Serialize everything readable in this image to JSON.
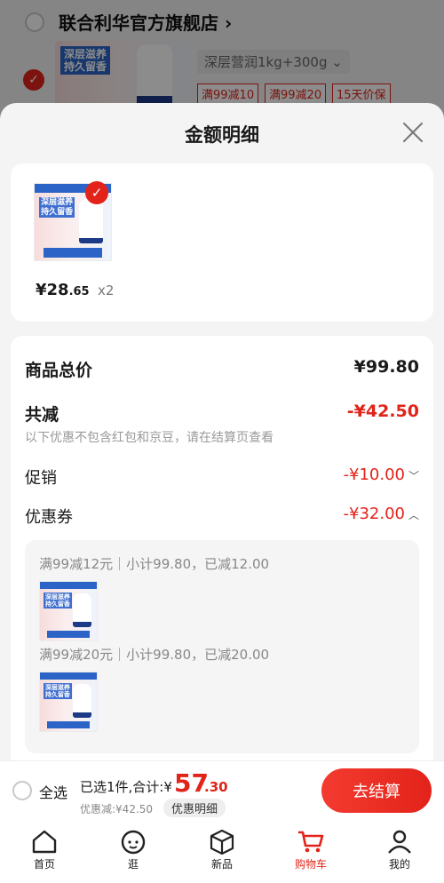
{
  "store": {
    "name": "联合利华官方旗舰店",
    "name_arrow": "›",
    "thumb_text": "深层滋养\n持久留香",
    "spec": "深层营润1kg+300g ⌄",
    "promo_tags": [
      "满99减10",
      "满99减20",
      "15天价保"
    ]
  },
  "sheet": {
    "title": "金额明细",
    "product": {
      "price_int": "¥28",
      "price_dec": ".65",
      "qty": "x2",
      "img_text": "深层滋养\n持久留香"
    },
    "total_label": "商品总价",
    "total_value": "¥99.80",
    "reduce_label": "共减",
    "reduce_value": "-¥42.50",
    "note": "以下优惠不包含红包和京豆，请在结算页查看",
    "promo_label": "促销",
    "promo_value": "-¥10.00",
    "coupon_label": "优惠券",
    "coupon_value": "-¥32.00",
    "coupons": [
      {
        "text": "满99减12元｜小计99.80，已减12.00"
      },
      {
        "text": "满99减20元｜小计99.80，已减20.00"
      }
    ]
  },
  "bottom": {
    "select_all": "全选",
    "summary": "已选1件,合计:¥",
    "total_int": "57",
    "total_dec": ".30",
    "discount": "优惠减:¥42.50",
    "detail_pill": "优惠明细",
    "checkout": "去结算"
  },
  "tabs": [
    {
      "label": "首页"
    },
    {
      "label": "逛"
    },
    {
      "label": "新品"
    },
    {
      "label": "购物车"
    },
    {
      "label": "我的"
    }
  ],
  "colors": {
    "accent": "#e2231a",
    "brand_blue": "#2b64c6"
  },
  "icons": [
    "close-icon",
    "check-icon",
    "home-icon",
    "browse-face-icon",
    "new-box-icon",
    "cart-icon",
    "profile-icon"
  ]
}
